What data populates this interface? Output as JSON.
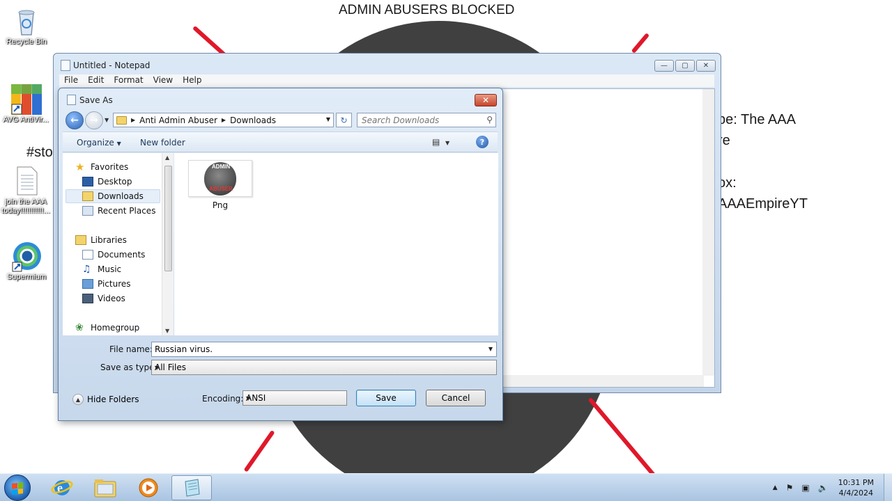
{
  "desktop": {
    "wallpaper_title": "ADMIN ABUSERS BLOCKED",
    "wallpaper_lines": [
      "be: The AAA",
      "re",
      "ox:",
      "AAAEmpireYT"
    ],
    "wallpaper_hashtag": "#sto",
    "icons": [
      {
        "label": "Recycle Bin",
        "icon": "recycle-bin-icon"
      },
      {
        "label": "AVG AntiVir...",
        "icon": "avg-antivirus-icon"
      },
      {
        "label": "join the AAA today!!!!!!!!!!!...",
        "icon": "text-file-icon"
      },
      {
        "label": "Supermium",
        "icon": "supermium-browser-icon"
      }
    ]
  },
  "notepad": {
    "title": "Untitled - Notepad",
    "menu": [
      "File",
      "Edit",
      "Format",
      "View",
      "Help"
    ]
  },
  "save_dialog": {
    "title": "Save As",
    "breadcrumb": [
      "Anti Admin Abuser",
      "Downloads"
    ],
    "search_placeholder": "Search Downloads",
    "toolbar": {
      "organize": "Organize",
      "new_folder": "New folder"
    },
    "nav": {
      "favorites_label": "Favorites",
      "favorites": [
        "Desktop",
        "Downloads",
        "Recent Places"
      ],
      "libraries_label": "Libraries",
      "libraries": [
        "Documents",
        "Music",
        "Pictures",
        "Videos"
      ],
      "homegroup": "Homegroup",
      "selected": "Downloads"
    },
    "files": [
      {
        "name": "Png",
        "thumb_top": "ADMIN",
        "thumb_bottom": "ABUSER"
      }
    ],
    "file_name_label": "File name:",
    "file_name_value": "Russian virus.",
    "save_as_type_label": "Save as type:",
    "save_as_type_value": "All Files",
    "encoding_label": "Encoding:",
    "encoding_value": "ANSI",
    "save_button": "Save",
    "cancel_button": "Cancel",
    "hide_folders": "Hide Folders"
  },
  "taskbar": {
    "apps": [
      "internet-explorer-icon",
      "file-explorer-icon",
      "media-player-icon",
      "notepad-icon"
    ],
    "clock_time": "10:31 PM",
    "clock_date": "4/4/2024"
  }
}
